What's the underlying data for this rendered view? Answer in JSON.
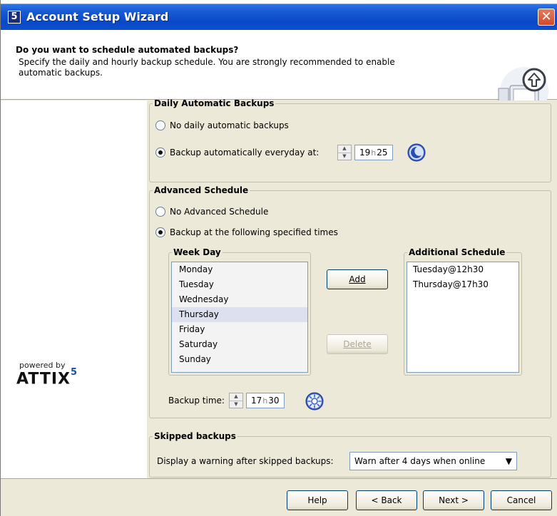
{
  "window": {
    "icon_glyph": "5",
    "title": "Account Setup Wizard",
    "close_glyph": "✕"
  },
  "header": {
    "title": "Do you want to schedule automated backups?",
    "desc_line1": "Specify the daily and hourly backup schedule. You are strongly recommended to enable",
    "desc_line2": "automatic backups.",
    "art_icon": "computer-upload-icon"
  },
  "branding": {
    "powered_by": "powered by",
    "logo": "ATTIX",
    "logo_sup": "5"
  },
  "daily": {
    "legend": "Daily Automatic Backups",
    "option_none": "No daily automatic backups",
    "option_everyday": "Backup automatically everyday at:",
    "selected": "everyday",
    "hours": "19",
    "h_sep": "h",
    "minutes": "25",
    "time_icon": "moon-icon"
  },
  "advanced": {
    "legend": "Advanced Schedule",
    "option_none": "No Advanced Schedule",
    "option_specified": "Backup at the following specified times",
    "selected": "specified",
    "weekday_legend": "Week Day",
    "weekdays": [
      "Monday",
      "Tuesday",
      "Wednesday",
      "Thursday",
      "Friday",
      "Saturday",
      "Sunday"
    ],
    "selected_weekday": "Thursday",
    "add_label": "Add",
    "delete_label": "Delete",
    "additional_legend": "Additional Schedule",
    "additional": [
      "Tuesday@12h30",
      "Thursday@17h30"
    ],
    "backup_time_label": "Backup time:",
    "hours": "17",
    "h_sep": "h",
    "minutes": "30",
    "time_icon": "sun-icon"
  },
  "skipped": {
    "legend": "Skipped backups",
    "label": "Display a warning after skipped backups:",
    "value": "Warn after 4 days when online"
  },
  "footer": {
    "help": "Help",
    "back": "< Back",
    "next": "Next >",
    "cancel": "Cancel"
  }
}
